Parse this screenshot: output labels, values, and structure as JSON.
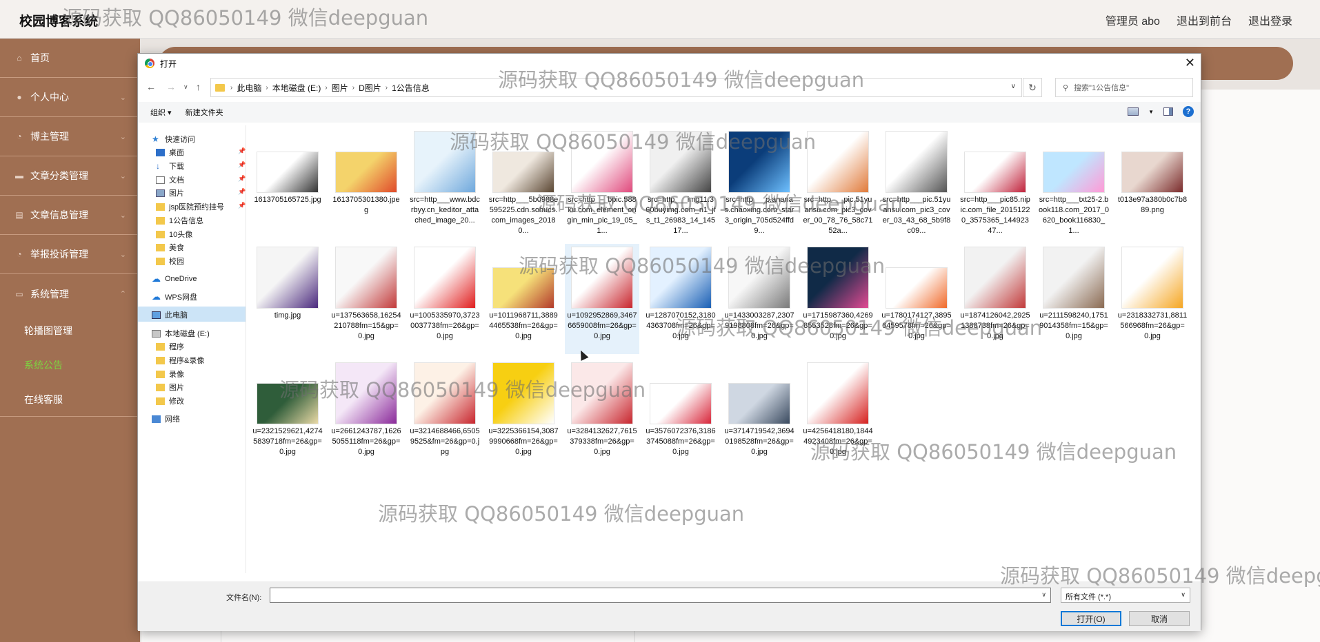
{
  "app": {
    "title": "校园博客系统",
    "admin_label": "管理员 abo",
    "to_frontend": "退出到前台",
    "logout": "退出登录"
  },
  "sidebar": {
    "items": [
      {
        "label": "首页",
        "icon": "home-icon",
        "has_arrow": false
      },
      {
        "label": "个人中心",
        "icon": "user-icon",
        "has_arrow": true
      },
      {
        "label": "博主管理",
        "icon": "clock-icon",
        "has_arrow": true
      },
      {
        "label": "文章分类管理",
        "icon": "category-icon",
        "has_arrow": true
      },
      {
        "label": "文章信息管理",
        "icon": "article-icon",
        "has_arrow": true
      },
      {
        "label": "举报投诉管理",
        "icon": "report-icon",
        "has_arrow": true
      },
      {
        "label": "系统管理",
        "icon": "system-icon",
        "has_arrow": true
      }
    ],
    "subitems": [
      {
        "label": "轮播图管理",
        "active": false
      },
      {
        "label": "系统公告",
        "active": true
      },
      {
        "label": "在线客服",
        "active": false
      }
    ]
  },
  "dialog": {
    "title": "打开",
    "breadcrumb": [
      "此电脑",
      "本地磁盘 (E:)",
      "图片",
      "D图片",
      "1公告信息"
    ],
    "search_placeholder": "搜索\"1公告信息\"",
    "toolbar": {
      "organize": "组织 ▾",
      "new_folder": "新建文件夹"
    },
    "nav": [
      {
        "label": "快速访问",
        "icon": "star",
        "indent": 0,
        "pinned": false
      },
      {
        "label": "桌面",
        "icon": "desk",
        "indent": 1,
        "pinned": true
      },
      {
        "label": "下载",
        "icon": "down",
        "indent": 1,
        "pinned": true
      },
      {
        "label": "文档",
        "icon": "doc",
        "indent": 1,
        "pinned": true
      },
      {
        "label": "图片",
        "icon": "pic",
        "indent": 1,
        "pinned": true
      },
      {
        "label": "jsp医院预约挂号",
        "icon": "folder",
        "indent": 1,
        "pinned": true
      },
      {
        "label": "1公告信息",
        "icon": "folder",
        "indent": 1,
        "pinned": false
      },
      {
        "label": "10头像",
        "icon": "folder",
        "indent": 1,
        "pinned": false
      },
      {
        "label": "美食",
        "icon": "folder",
        "indent": 1,
        "pinned": false
      },
      {
        "label": "校园",
        "icon": "folder",
        "indent": 1,
        "pinned": false
      },
      {
        "label": "OneDrive",
        "icon": "cloud",
        "indent": 0,
        "pinned": false
      },
      {
        "label": "WPS网盘",
        "icon": "cloud",
        "indent": 0,
        "pinned": false
      },
      {
        "label": "此电脑",
        "icon": "pc",
        "indent": 0,
        "pinned": false,
        "selected": true
      },
      {
        "label": "本地磁盘 (E:)",
        "icon": "drive",
        "indent": 0,
        "pinned": false
      },
      {
        "label": "程序",
        "icon": "folder",
        "indent": 1,
        "pinned": false
      },
      {
        "label": "程序&录像",
        "icon": "folder",
        "indent": 1,
        "pinned": false
      },
      {
        "label": "录像",
        "icon": "folder",
        "indent": 1,
        "pinned": false
      },
      {
        "label": "图片",
        "icon": "folder",
        "indent": 1,
        "pinned": false
      },
      {
        "label": "修改",
        "icon": "folder",
        "indent": 1,
        "pinned": false
      },
      {
        "label": "网络",
        "icon": "net",
        "indent": 0,
        "pinned": false
      }
    ],
    "files": [
      {
        "name": "1613705165725.jpg",
        "colors": [
          "#ffffff",
          "#333333"
        ],
        "aspect": "wide"
      },
      {
        "name": "1613705301380.jpeg",
        "colors": [
          "#f4d36b",
          "#e04a2a"
        ],
        "aspect": "wide"
      },
      {
        "name": "src=http___www.bdcrbyy.cn_keditor_attached_image_20...",
        "colors": [
          "#e7f3fb",
          "#6fa8dc"
        ],
        "aspect": "square"
      },
      {
        "name": "src=http___5b0988e595225.cdn.sohucs.com_images_20180...",
        "colors": [
          "#efe8df",
          "#5a4632"
        ],
        "aspect": "wide"
      },
      {
        "name": "src=http___bpic.588ku.com_element_origin_min_pic_19_05_1...",
        "colors": [
          "#ffffff",
          "#e0497c"
        ],
        "aspect": "square"
      },
      {
        "name": "src=http___img11.360buyimg.com_n1_jfs_t1_26983_14_14517...",
        "colors": [
          "#f0f0f0",
          "#444444"
        ],
        "aspect": "square"
      },
      {
        "name": "src=http___p.ananas.chaoxing.com_star3_origin_705d524ffd9...",
        "colors": [
          "#0b3d7a",
          "#6ec0ff"
        ],
        "aspect": "square"
      },
      {
        "name": "src=http___pic.51yuansu.com_pic3_cover_00_78_76_58c7152a...",
        "colors": [
          "#ffffff",
          "#e07a3a"
        ],
        "aspect": "square"
      },
      {
        "name": "src=http___pic.51yuansu.com_pic3_cover_03_43_68_5b9f8c09...",
        "colors": [
          "#ffffff",
          "#555555"
        ],
        "aspect": "square"
      },
      {
        "name": "src=http___pic85.nipic.com_file_20151220_3575365_14492347...",
        "colors": [
          "#ffffff",
          "#c0213a"
        ],
        "aspect": "wide"
      },
      {
        "name": "src=http___txt25-2.book118.com_2017_0620_book116830_1...",
        "colors": [
          "#bfe6ff",
          "#ff9ad6"
        ],
        "aspect": "wide"
      },
      {
        "name": "t013e97a380b0c7b889.png",
        "colors": [
          "#e8d7cf",
          "#7a2b2b"
        ],
        "aspect": "wide"
      },
      {
        "name": "timg.jpg",
        "colors": [
          "#f5f5f5",
          "#4b2a7d"
        ],
        "aspect": "square"
      },
      {
        "name": "u=137563658,16254210788fm=15&gp=0.jpg",
        "colors": [
          "#f8f8f8",
          "#c23a3a"
        ],
        "aspect": "square"
      },
      {
        "name": "u=1005335970,37230037738fm=26&gp=0.jpg",
        "colors": [
          "#ffffff",
          "#e01e1e"
        ],
        "aspect": "square"
      },
      {
        "name": "u=1011968711,38894465538fm=26&gp=0.jpg",
        "colors": [
          "#f6e17a",
          "#b23a2a"
        ],
        "aspect": "wide"
      },
      {
        "name": "u=1092952869,34676659008fm=26&gp=0.jpg",
        "colors": [
          "#ffffff",
          "#c8262e"
        ],
        "aspect": "square",
        "selected": true
      },
      {
        "name": "u=1287070152,31804363708fm=26&gp=0.jpg",
        "colors": [
          "#e3f1ff",
          "#1a5fb4"
        ],
        "aspect": "square"
      },
      {
        "name": "u=1433003287,23079198808fm=26&gp=0.jpg",
        "colors": [
          "#f7f7f7",
          "#7a7a7a"
        ],
        "aspect": "square"
      },
      {
        "name": "u=1715987360,42698553528fm=26&gp=0.jpg",
        "colors": [
          "#102a47",
          "#e24b93"
        ],
        "aspect": "square"
      },
      {
        "name": "u=1780174127,38956459578fm=26&gp=0.jpg",
        "colors": [
          "#ffffff",
          "#f06a2a"
        ],
        "aspect": "wide"
      },
      {
        "name": "u=1874126042,29251388738fm=26&gp=0.jpg",
        "colors": [
          "#f2f2f2",
          "#c23a3a"
        ],
        "aspect": "square"
      },
      {
        "name": "u=2111598240,17519014358fm=15&gp=0.jpg",
        "colors": [
          "#f2f2f2",
          "#8a6a52"
        ],
        "aspect": "square"
      },
      {
        "name": "u=2318332731,8811566968fm=26&gp=0.jpg",
        "colors": [
          "#ffffff",
          "#f5a623"
        ],
        "aspect": "square"
      },
      {
        "name": "u=2321529621,42745839718fm=26&gp=0.jpg",
        "colors": [
          "#2f5d3a",
          "#e9d9a6"
        ],
        "aspect": "wide"
      },
      {
        "name": "u=2661243787,16265055118fm=26&gp=0.jpg",
        "colors": [
          "#f4e7f7",
          "#8a2a9a"
        ],
        "aspect": "square"
      },
      {
        "name": "u=3214688466,65059525&fm=26&gp=0.jpg",
        "colors": [
          "#fdf1e6",
          "#c8262e"
        ],
        "aspect": "square"
      },
      {
        "name": "u=3225366154,30879990668fm=26&gp=0.jpg",
        "colors": [
          "#f7cf12",
          "#ffffff"
        ],
        "aspect": "square"
      },
      {
        "name": "u=3284132627,7615379338fm=26&gp=0.jpg",
        "colors": [
          "#fbe8e8",
          "#c8262e"
        ],
        "aspect": "square"
      },
      {
        "name": "u=3576072376,31863745088fm=26&gp=0.jpg",
        "colors": [
          "#ffffff",
          "#d8263a"
        ],
        "aspect": "wide"
      },
      {
        "name": "u=3714719542,36940198528fm=26&gp=0.jpg",
        "colors": [
          "#cfd7e2",
          "#3a4a5f"
        ],
        "aspect": "wide"
      },
      {
        "name": "u=4256418180,18444923408fm=26&gp=0.jpg",
        "colors": [
          "#ffffff",
          "#d6211f"
        ],
        "aspect": "square"
      }
    ],
    "filename_label": "文件名(N):",
    "filename_value": "",
    "filetype": "所有文件 (*.*)",
    "open_label": "打开(O)",
    "cancel_label": "取消"
  },
  "watermark": "源码获取 QQ86050149 微信deepguan"
}
